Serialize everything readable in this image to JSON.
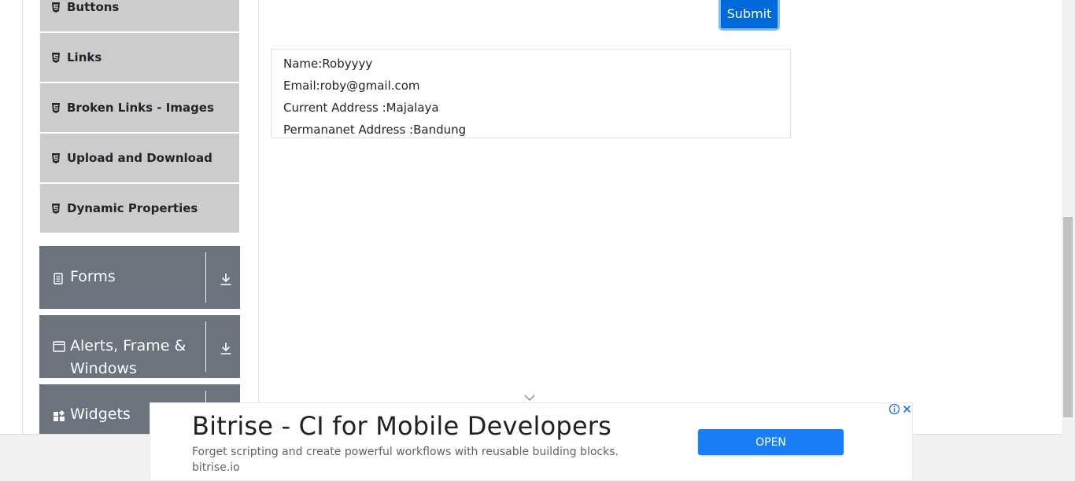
{
  "sidebar": {
    "elements_items": [
      {
        "label": "Buttons"
      },
      {
        "label": "Links"
      },
      {
        "label": "Broken Links - Images"
      },
      {
        "label": "Upload and Download"
      },
      {
        "label": "Dynamic Properties"
      }
    ],
    "groups": [
      {
        "label": "Forms",
        "icon": "document-icon"
      },
      {
        "label_line1": "Alerts, Frame &",
        "label_line2": "Windows",
        "icon": "window-icon"
      },
      {
        "label": "Widgets",
        "icon": "widgets-icon"
      }
    ]
  },
  "form": {
    "submit_label": "Submit"
  },
  "output": {
    "name": "Name:Robyyyy",
    "email": "Email:roby@gmail.com",
    "current_address": "Current Address :Majalaya",
    "permanent_address": "Permananet Address :Bandung"
  },
  "ad": {
    "title": "Bitrise - CI for Mobile Developers",
    "description": "Forget scripting and create powerful workflows with reusable building blocks.",
    "domain": "bitrise.io",
    "cta": "OPEN"
  },
  "colors": {
    "menu_item_bg": "#cccccc",
    "group_bg": "#6c737c",
    "submit_bg": "#0069d9",
    "ad_cta_bg": "#1a7ff6"
  }
}
